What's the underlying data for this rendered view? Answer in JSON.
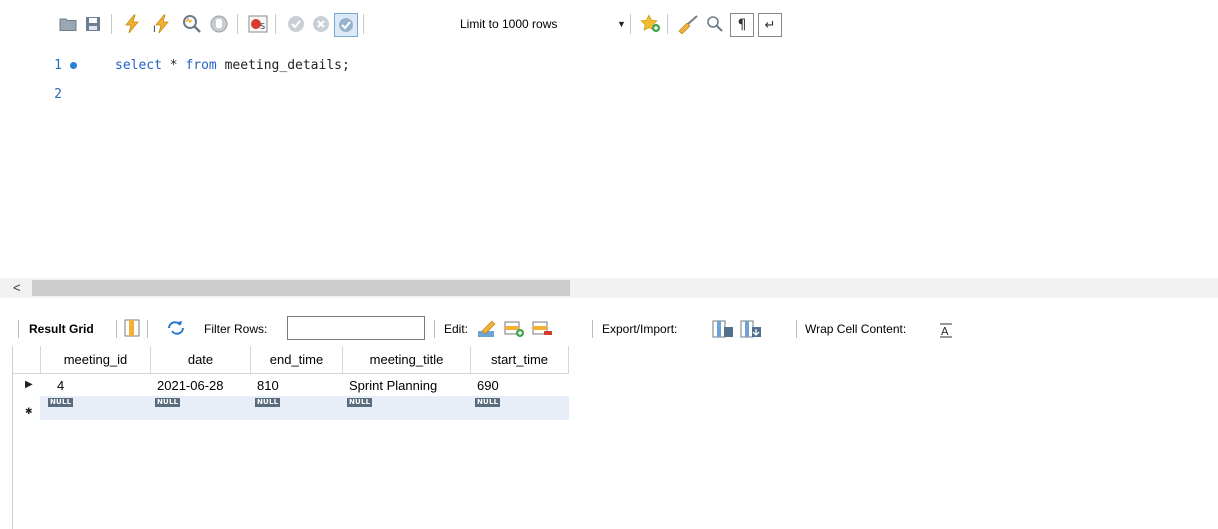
{
  "toolbar": {
    "limit_label": "Limit to 1000 rows",
    "icons": [
      "open-folder-icon",
      "save-icon",
      "execute-icon",
      "execute-current-icon",
      "explain-icon",
      "stop-icon",
      "toggle-error-icon",
      "commit-icon",
      "rollback-icon",
      "autocommit-icon",
      "limit-select",
      "add-snippet-icon",
      "beautify-icon",
      "find-icon",
      "invisible-chars-icon",
      "wrap-icon"
    ]
  },
  "editor": {
    "lines": [
      {
        "num": "1",
        "code_keyword_1": "select",
        "code_mid": " * ",
        "code_keyword_2": "from",
        "code_rest": " meeting_details;"
      },
      {
        "num": "2"
      }
    ]
  },
  "scroll": {
    "left_arrow": "<"
  },
  "result_toolbar": {
    "result_grid": "Result Grid",
    "filter_rows": "Filter Rows:",
    "filter_value": "",
    "edit": "Edit:",
    "export_import": "Export/Import:",
    "wrap": "Wrap Cell Content:"
  },
  "grid": {
    "columns": [
      "meeting_id",
      "date",
      "end_time",
      "meeting_title",
      "start_time"
    ],
    "rows": [
      [
        "4",
        "2021-06-28",
        "810",
        "Sprint Planning",
        "690"
      ]
    ],
    "null_label": "NULL"
  },
  "colors": {
    "keyword": "#2461c7",
    "line_number": "#2a6fb0",
    "null_badge": "#5a6c7e"
  }
}
